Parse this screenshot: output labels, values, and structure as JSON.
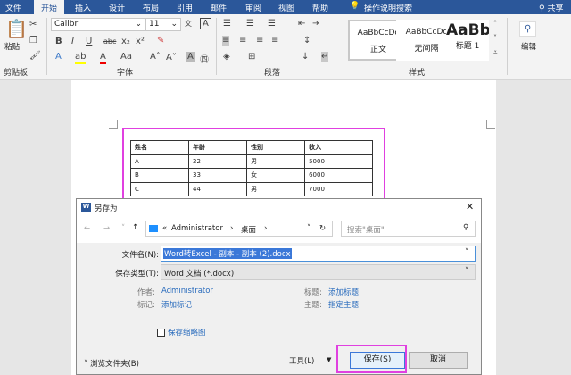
{
  "ribbon": {
    "tabs": [
      "文件",
      "开始",
      "插入",
      "设计",
      "布局",
      "引用",
      "邮件",
      "审阅",
      "视图",
      "帮助"
    ],
    "active_tab": "开始",
    "tell_me": "操作说明搜索",
    "share": "共享",
    "font_name": "Calibri",
    "font_size": "11",
    "paste": "粘贴",
    "groups": {
      "clipboard": "剪贴板",
      "font": "字体",
      "paragraph": "段落",
      "styles": "样式"
    },
    "styles": [
      {
        "preview": "AaBbCcDc",
        "name": "正文"
      },
      {
        "preview": "AaBbCcDc",
        "name": "无间隔"
      },
      {
        "preview": "AaBb",
        "name": "标题 1"
      }
    ],
    "edit": "编辑",
    "accent": "#2b579a"
  },
  "table": {
    "headers": [
      "姓名",
      "年龄",
      "性别",
      "收入"
    ],
    "rows": [
      [
        "A",
        "22",
        "男",
        "5000"
      ],
      [
        "B",
        "33",
        "女",
        "6000"
      ],
      [
        "C",
        "44",
        "男",
        "7000"
      ]
    ]
  },
  "dialog": {
    "title": "另存为",
    "path": [
      "Administrator",
      "桌面"
    ],
    "search_placeholder": "搜索\"桌面\"",
    "filename_label": "文件名(N):",
    "filename": "Word转Excel - 副本 - 副本 (2).docx",
    "type_label": "保存类型(T):",
    "type": "Word 文档 (*.docx)",
    "author_label": "作者:",
    "author": "Administrator",
    "tags_label": "标记:",
    "tags": "添加标记",
    "title_label": "标题:",
    "title_value": "添加标题",
    "subject_label": "主题:",
    "subject": "指定主题",
    "thumbnail": "保存缩略图",
    "browse": "浏览文件夹(B)",
    "tools": "工具(L)",
    "save": "保存(S)",
    "cancel": "取消"
  }
}
